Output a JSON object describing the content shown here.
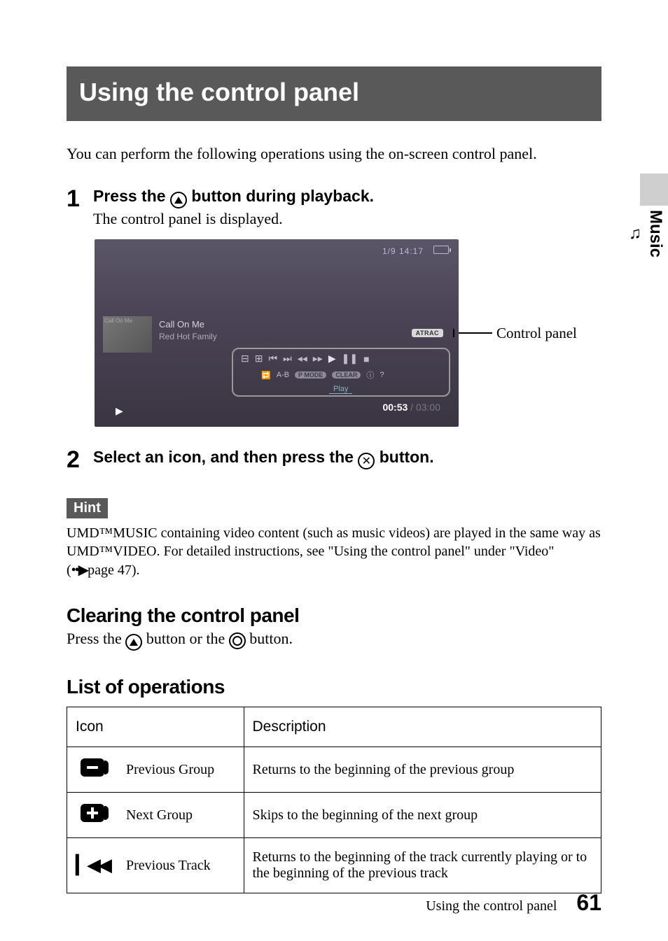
{
  "title": "Using the control panel",
  "intro": "You can perform the following operations using the on-screen control panel.",
  "steps": [
    {
      "num": "1",
      "title_pre": "Press the ",
      "title_post": " button during playback.",
      "sub": "The control panel is displayed."
    },
    {
      "num": "2",
      "title_pre": "Select an icon, and then press the ",
      "title_post": " button."
    }
  ],
  "screenshot": {
    "status": "1/9 14:17",
    "thumb_caption": "Call On Me",
    "track": "Call On Me",
    "artist": "Red Hot Family",
    "codec": "ATRAC",
    "row2_ab": "A-B",
    "row2_pmode": "P MODE",
    "row2_clear": "CLEAR",
    "play_label": "Play",
    "time_current": "00:53",
    "time_sep": " / ",
    "time_total": "03:00"
  },
  "callout": "Control panel",
  "hint_label": "Hint",
  "hint_body": "UMD™MUSIC containing video content (such as music videos) are played in the same way as UMD™VIDEO. For detailed instructions, see \"Using the control panel\" under \"Video\" (",
  "hint_xref": "page 47).",
  "h2_clear": "Clearing the control panel",
  "clear_pre": "Press the ",
  "clear_mid": " button or the ",
  "clear_post": " button.",
  "h2_list": "List of operations",
  "table": {
    "headers": {
      "icon": "Icon",
      "desc": "Description"
    },
    "rows": [
      {
        "name": "Previous Group",
        "desc": "Returns to the beginning of the previous group"
      },
      {
        "name": "Next Group",
        "desc": "Skips to the beginning of the next group"
      },
      {
        "name": "Previous Track",
        "desc": "Returns to the beginning of the track currently playing or to the beginning of the previous track"
      }
    ]
  },
  "side": {
    "section": "Music"
  },
  "footer": {
    "text": "Using the control panel",
    "page": "61"
  }
}
